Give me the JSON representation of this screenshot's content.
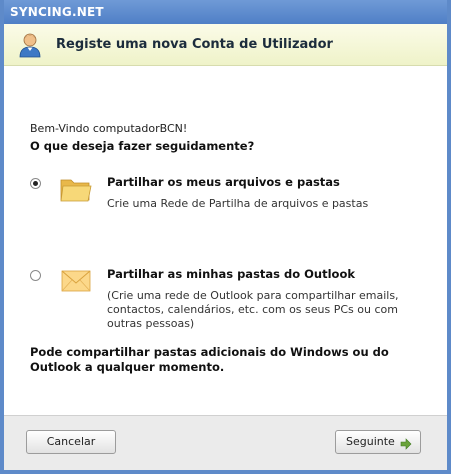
{
  "window": {
    "title": "SYNCING.NET",
    "colors": {
      "titlebar": "#5e8ac9",
      "banner": "#f3f6d5",
      "footer": "#ebebeb",
      "accent_arrow": "#6aa33a"
    }
  },
  "banner": {
    "icon": "user-icon",
    "title": "Registe uma nova Conta de Utilizador"
  },
  "content": {
    "welcome": "Bem-Vindo computadorBCN!",
    "question": "O que deseja fazer seguidamente?",
    "options": [
      {
        "selected": true,
        "icon": "folder-icon",
        "title": "Partilhar os meus arquivos e pastas",
        "description": "Crie uma Rede de Partilha de arquivos e pastas"
      },
      {
        "selected": false,
        "icon": "envelope-icon",
        "title": "Partilhar as minhas pastas do Outlook",
        "description": "(Crie uma rede de Outlook para compartilhar emails, contactos, calendários, etc. com os seus PCs ou com outras pessoas)"
      }
    ],
    "note": "Pode compartilhar pastas adicionais do Windows ou do Outlook a qualquer momento."
  },
  "footer": {
    "cancel_label": "Cancelar",
    "next_label": "Seguinte"
  }
}
